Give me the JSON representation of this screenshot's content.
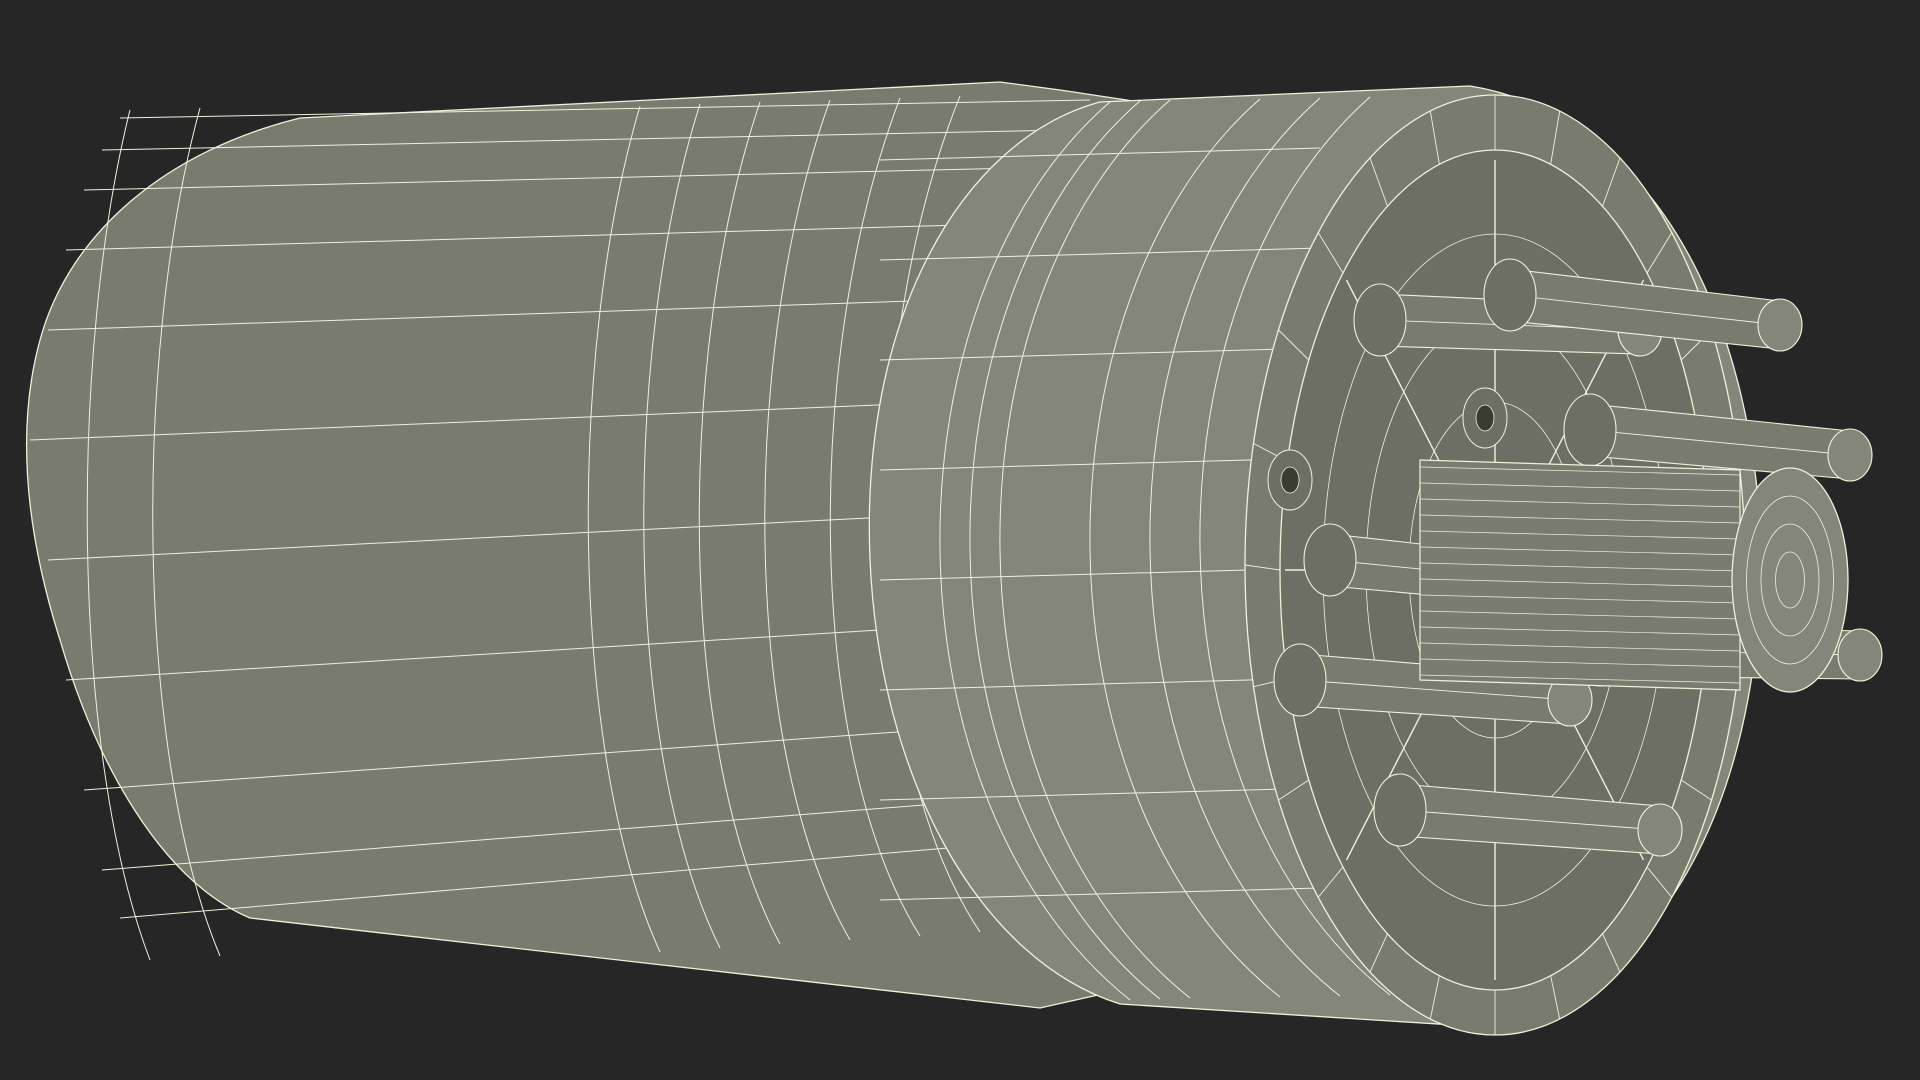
{
  "scene": {
    "subject": "octal-tube-base-wireframe",
    "render_mode": "wireframe-on-shaded",
    "colors": {
      "background": "#262626",
      "surface": "#7a7b6f",
      "surface_dark": "#6e6f64",
      "surface_light": "#85867a",
      "wire": "#f2f0da",
      "shadow": "#3a3b35"
    },
    "pin_count": 8,
    "has_center_key_post": true
  }
}
